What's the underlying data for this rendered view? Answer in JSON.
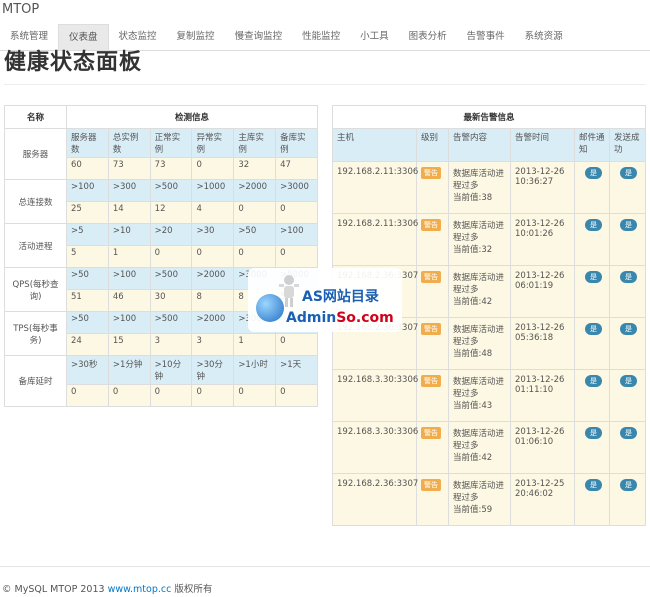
{
  "brand": "MTOP",
  "nav": [
    "系统管理",
    "仪表盘",
    "状态监控",
    "复制监控",
    "慢查询监控",
    "性能监控",
    "小工具",
    "图表分析",
    "告警事件",
    "系统资源"
  ],
  "page_title": "健康状态面板",
  "health": {
    "col_name": "名称",
    "col_info": "检测信息",
    "sections": [
      {
        "label": "服务器",
        "limits": [
          "服务器数",
          "总实例数",
          "正常实例",
          "异常实例",
          "主库实例",
          "备库实例"
        ],
        "counts": [
          "60",
          "73",
          "73",
          "0",
          "32",
          "47"
        ]
      },
      {
        "label": "总连接数",
        "limits": [
          ">100",
          ">300",
          ">500",
          ">1000",
          ">2000",
          ">3000"
        ],
        "counts": [
          "25",
          "14",
          "12",
          "4",
          "0",
          "0"
        ]
      },
      {
        "label": "活动进程",
        "limits": [
          ">5",
          ">10",
          ">20",
          ">30",
          ">50",
          ">100"
        ],
        "counts": [
          "5",
          "1",
          "0",
          "0",
          "0",
          "0"
        ]
      },
      {
        "label": "QPS(每秒查询)",
        "limits": [
          ">50",
          ">100",
          ">500",
          ">2000",
          ">3000",
          ">5000"
        ],
        "counts": [
          "51",
          "46",
          "30",
          "8",
          "8",
          "5"
        ]
      },
      {
        "label": "TPS(每秒事务)",
        "limits": [
          ">50",
          ">100",
          ">500",
          ">2000",
          ">3000",
          ">5000"
        ],
        "counts": [
          "24",
          "15",
          "3",
          "3",
          "1",
          "0"
        ]
      },
      {
        "label": "备库延时",
        "limits": [
          ">30秒",
          ">1分钟",
          ">10分钟",
          ">30分钟",
          ">1小时",
          ">1天"
        ],
        "counts": [
          "0",
          "0",
          "0",
          "0",
          "0",
          "0"
        ]
      }
    ]
  },
  "alerts": {
    "title": "最新告警信息",
    "columns": [
      "主机",
      "级别",
      "告警内容",
      "告警时间",
      "邮件通知",
      "发送成功"
    ],
    "level_label": "警告",
    "yes_label": "是",
    "rows": [
      {
        "host": "192.168.2.11:3306",
        "msg1": "数据库活动进",
        "msg2": "程过多",
        "msg3": "当前值:38",
        "date": "2013-12-26",
        "time": "10:36:27"
      },
      {
        "host": "192.168.2.11:3306",
        "msg1": "数据库活动进",
        "msg2": "程过多",
        "msg3": "当前值:32",
        "date": "2013-12-26",
        "time": "10:01:26"
      },
      {
        "host": "192.168.2.36:3307",
        "msg1": "数据库活动进",
        "msg2": "程过多",
        "msg3": "当前值:42",
        "date": "2013-12-26",
        "time": "06:01:19"
      },
      {
        "host": "192.168.2.36:3307",
        "msg1": "数据库活动进",
        "msg2": "程过多",
        "msg3": "当前值:48",
        "date": "2013-12-26",
        "time": "05:36:18"
      },
      {
        "host": "192.168.3.30:3306",
        "msg1": "数据库活动进",
        "msg2": "程过多",
        "msg3": "当前值:43",
        "date": "2013-12-26",
        "time": "01:11:10"
      },
      {
        "host": "192.168.3.30:3306",
        "msg1": "数据库活动进",
        "msg2": "程过多",
        "msg3": "当前值:42",
        "date": "2013-12-26",
        "time": "01:06:10"
      },
      {
        "host": "192.168.2.36:3307",
        "msg1": "数据库活动进",
        "msg2": "程过多",
        "msg3": "当前值:59",
        "date": "2013-12-25",
        "time": "20:46:02"
      }
    ]
  },
  "watermark": {
    "line1": "AS网站目录",
    "line2a": "Admin",
    "line2b": "So.com"
  },
  "footer": {
    "prefix": "© MySQL MTOP 2013 ",
    "link": "www.mtop.cc",
    "suffix": " 版权所有"
  }
}
